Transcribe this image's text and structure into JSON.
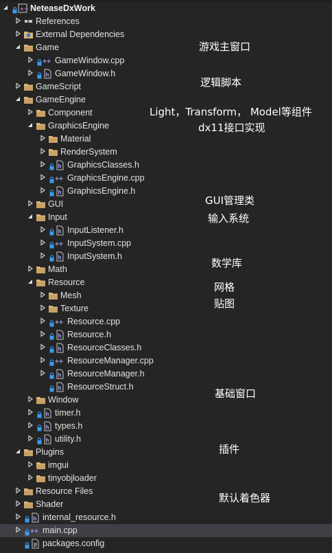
{
  "tree": {
    "solution": "NeteaseDxWork",
    "items": [
      {
        "label": "References"
      },
      {
        "label": "External Dependencies"
      },
      {
        "label": "Game"
      },
      {
        "label": "GameWindow.cpp"
      },
      {
        "label": "GameWindow.h"
      },
      {
        "label": "GameScript"
      },
      {
        "label": "GameEngine"
      },
      {
        "label": "Component"
      },
      {
        "label": "GraphicsEngine"
      },
      {
        "label": "Material"
      },
      {
        "label": "RenderSystem"
      },
      {
        "label": "GraphicsClasses.h"
      },
      {
        "label": "GraphicsEngine.cpp"
      },
      {
        "label": "GraphicsEngine.h"
      },
      {
        "label": "GUI"
      },
      {
        "label": "Input"
      },
      {
        "label": "InputListener.h"
      },
      {
        "label": "InputSystem.cpp"
      },
      {
        "label": "InputSystem.h"
      },
      {
        "label": "Math"
      },
      {
        "label": "Resource"
      },
      {
        "label": "Mesh"
      },
      {
        "label": "Texture"
      },
      {
        "label": "Resource.cpp"
      },
      {
        "label": "Resource.h"
      },
      {
        "label": "ResourceClasses.h"
      },
      {
        "label": "ResourceManager.cpp"
      },
      {
        "label": "ResourceManager.h"
      },
      {
        "label": "ResourceStruct.h"
      },
      {
        "label": "Window"
      },
      {
        "label": "timer.h"
      },
      {
        "label": "types.h"
      },
      {
        "label": "utility.h"
      },
      {
        "label": "Plugins"
      },
      {
        "label": "imgui"
      },
      {
        "label": "tinyobjloader"
      },
      {
        "label": "Resource Files"
      },
      {
        "label": "Shader"
      },
      {
        "label": "internal_resource.h"
      },
      {
        "label": "main.cpp"
      },
      {
        "label": "packages.config"
      }
    ]
  },
  "annotations": [
    "游戏主窗口",
    "逻辑脚本",
    "Light，Transform， Model等组件",
    "dx11接口实现",
    "GUI管理类",
    "输入系统",
    "数学库",
    "网格",
    "贴图",
    "基础窗口",
    "插件",
    "默认着色器"
  ],
  "colors": {
    "background": "#252526",
    "text": "#e2e2e2",
    "folder": "#dcb67a",
    "cpp_icon": "#9b9bdf",
    "header_icon": "#9b9bdf",
    "selected_row": "#3f3f46"
  }
}
